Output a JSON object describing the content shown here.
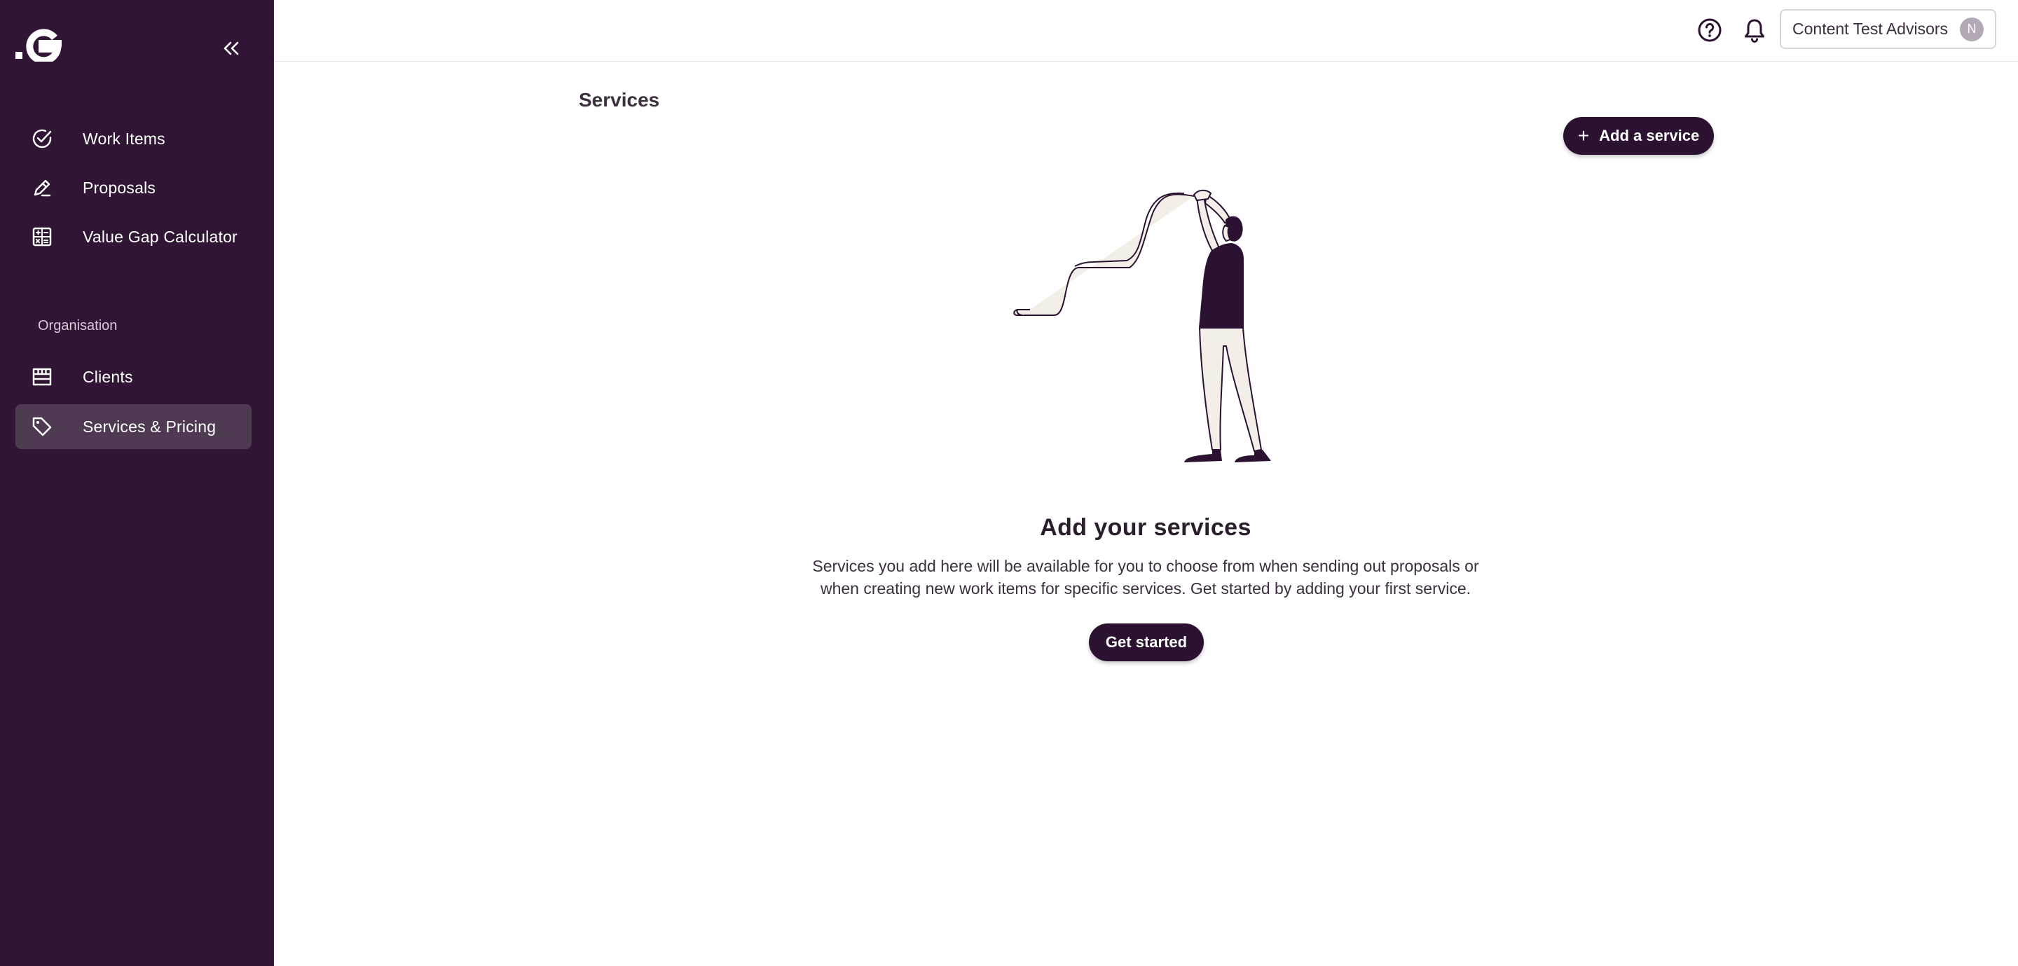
{
  "sidebar": {
    "logo_text": ".G",
    "collapse_icon": "double-chevron-left-icon",
    "items": [
      {
        "label": "Work Items",
        "icon": "check-circle-icon"
      },
      {
        "label": "Proposals",
        "icon": "pen-icon"
      },
      {
        "label": "Value Gap Calculator",
        "icon": "calculator-icon"
      }
    ],
    "section_title": "Organisation",
    "org_items": [
      {
        "label": "Clients",
        "icon": "store-icon",
        "active": false
      },
      {
        "label": "Services & Pricing",
        "icon": "tag-icon",
        "active": true
      }
    ]
  },
  "topbar": {
    "help_icon": "help-circle-icon",
    "notifications_icon": "bell-icon",
    "org_name": "Content Test Advisors",
    "avatar_initial": "N"
  },
  "main": {
    "page_title": "Services",
    "add_button_label": "Add a service",
    "add_button_icon": "plus-icon",
    "empty_state": {
      "illustration": "person-reading-long-receipt-illustration",
      "title": "Add your services",
      "description": "Services you add here will be available for you to choose from when sending out proposals or when creating new work items for specific services. Get started by adding your first service.",
      "cta_label": "Get started"
    }
  },
  "colors": {
    "sidebar_bg": "#301634",
    "sidebar_active": "#4e3b52",
    "primary": "#2a1230",
    "illustration_fill": "#f3efe8"
  }
}
